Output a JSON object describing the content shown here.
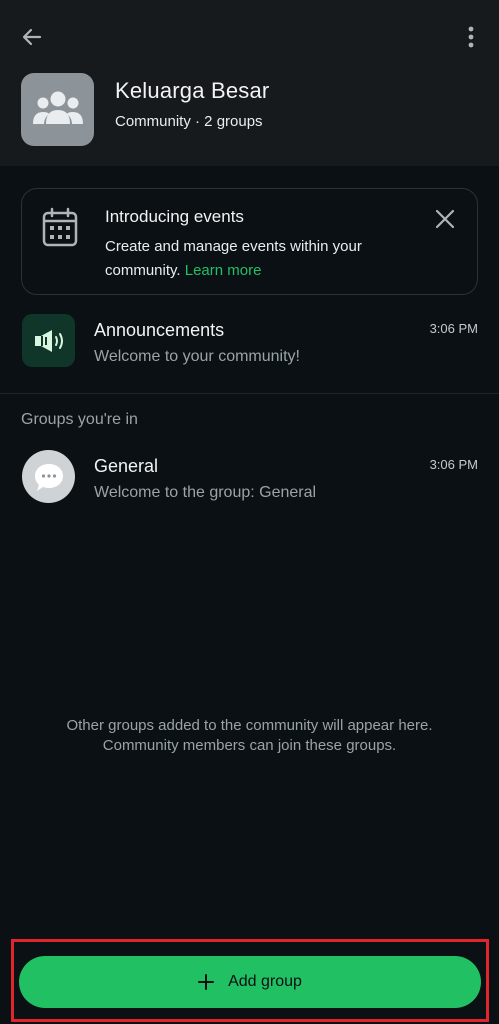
{
  "header": {
    "community_name": "Keluarga Besar",
    "community_subtitle": "Community · 2 groups",
    "back_icon": "arrow-left-icon",
    "menu_icon": "more-vert-icon",
    "avatar_icon": "community-group-icon"
  },
  "events_card": {
    "title": "Introducing events",
    "description": "Create and manage events within your community.",
    "learn_more": "Learn more",
    "icon": "calendar-icon",
    "close_icon": "close-icon"
  },
  "announcements": {
    "name": "Announcements",
    "time": "3:06 PM",
    "preview": "Welcome to your community!",
    "icon": "megaphone-icon"
  },
  "groups_section": {
    "label": "Groups you're in",
    "items": [
      {
        "name": "General",
        "time": "3:06 PM",
        "preview": "Welcome to the group: General",
        "icon": "chat-bubble-icon"
      }
    ]
  },
  "info": {
    "line1": "Other groups added to the community will appear here.",
    "line2": "Community members can join these groups."
  },
  "add_group": {
    "label": "Add group",
    "icon": "plus-icon"
  },
  "colors": {
    "background": "#0b1014",
    "header_bg": "#161a1d",
    "accent_green": "#21c063",
    "highlight_red": "#e0252f"
  }
}
